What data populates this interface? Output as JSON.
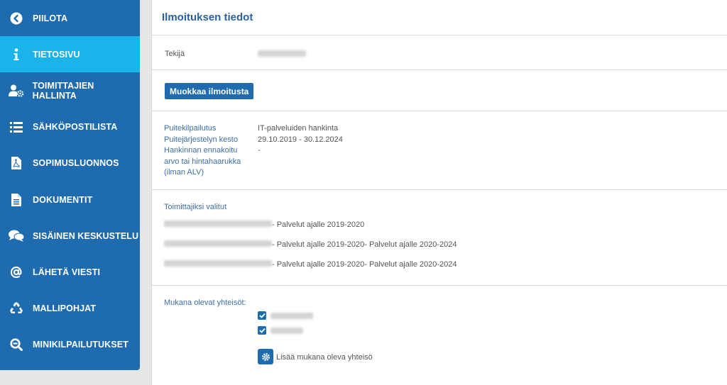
{
  "sidebar": {
    "items": [
      {
        "label": "PIILOTA",
        "icon": "chevron-left-circle-icon"
      },
      {
        "label": "TIETOSIVU",
        "icon": "info-icon",
        "active": true
      },
      {
        "label": "TOIMITTAJIEN HALLINTA",
        "icon": "user-gear-icon"
      },
      {
        "label": "SÄHKÖPOSTILISTA",
        "icon": "list-icon"
      },
      {
        "label": "SOPIMUSLUONNOS",
        "icon": "pdf-file-icon"
      },
      {
        "label": "DOKUMENTIT",
        "icon": "document-icon"
      },
      {
        "label": "SISÄINEN KESKUSTELU",
        "icon": "chat-icon"
      },
      {
        "label": "LÄHETÄ VIESTI",
        "icon": "at-sign-icon"
      },
      {
        "label": "MALLIPOHJAT",
        "icon": "recycle-icon"
      },
      {
        "label": "MINIKILPAILUTUKSET",
        "icon": "zoom-out-icon"
      }
    ]
  },
  "main": {
    "title": "Ilmoituksen tiedot",
    "author_label": "Tekijä",
    "edit_button": "Muokkaa ilmoitusta",
    "info": {
      "label_tender": "Puitekilpailutus",
      "value_tender": "IT-palveluiden hankinta",
      "label_duration": "Puitejärjestelyn kesto",
      "value_duration": "29.10.2019 - 30.12.2024",
      "label_estimate_1": "Hankinnan ennakoitu",
      "label_estimate_2": "arvo tai hintahaarukka",
      "label_estimate_3": "(ilman ALV)",
      "value_estimate": "-"
    },
    "suppliers": {
      "heading": "Toimittajiksi valitut",
      "rows": [
        "- Palvelut ajalle 2019-2020",
        "- Palvelut ajalle 2019-2020- Palvelut ajalle 2020-2024",
        "- Palvelut ajalle 2019-2020- Palvelut ajalle 2020-2024"
      ]
    },
    "orgs": {
      "heading": "Mukana olevat yhteisöt:",
      "add_label": "Lisää mukana oleva yhteisö"
    }
  },
  "colors": {
    "sidebar": "#1e6bb0",
    "sidebar_active": "#1bb4ea",
    "accent_text": "#2a62a0"
  }
}
